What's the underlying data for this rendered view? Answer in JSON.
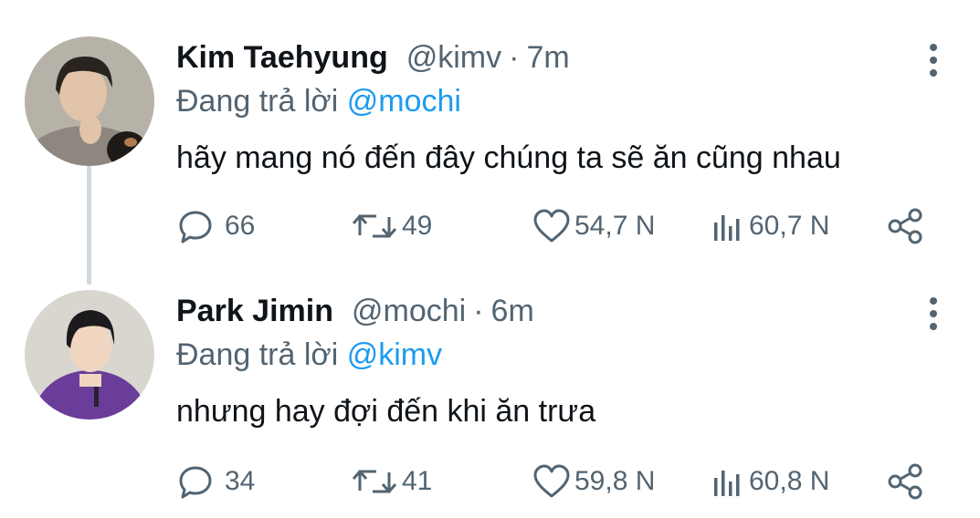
{
  "tweets": [
    {
      "display_name": "Kim Taehyung",
      "handle": "@kimv",
      "separator": "·",
      "time": "7m",
      "replying_prefix": "Đang trả lời",
      "replying_to": "@mochi",
      "text": "hãy mang nó đến đây chúng ta sẽ ăn cũng nhau",
      "replies": "66",
      "retweets": "49",
      "likes": "54,7 N",
      "views": "60,7 N",
      "avatar_colors": {
        "bg": "#b7b2a8",
        "shirt": "#8d8780",
        "skin": "#e2c4a8",
        "hair": "#2a2420"
      }
    },
    {
      "display_name": "Park Jimin",
      "handle": "@mochi",
      "separator": "·",
      "time": "6m",
      "replying_prefix": "Đang trả lời",
      "replying_to": "@kimv",
      "text": "nhưng hay đợi đến khi ăn trưa",
      "replies": "34",
      "retweets": "41",
      "likes": "59,8 N",
      "views": "60,8 N",
      "avatar_colors": {
        "bg": "#d8d6cf",
        "shirt": "#6a3d9a",
        "skin": "#f0d6c0",
        "hair": "#1c1a1c"
      }
    }
  ],
  "icons": {
    "more": "more-vertical-icon",
    "reply": "reply-icon",
    "retweet": "retweet-icon",
    "like": "heart-icon",
    "views": "views-icon",
    "share": "share-icon"
  },
  "colors": {
    "text": "#0f1419",
    "secondary": "#536471",
    "mention": "#1d9bf0",
    "thread_line": "#cfd9de"
  }
}
